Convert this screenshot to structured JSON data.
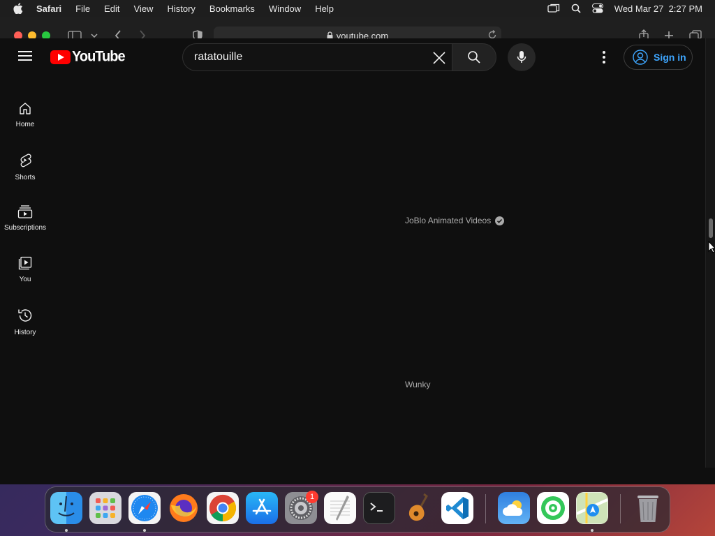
{
  "menubar": {
    "app_name": "Safari",
    "menus": [
      "File",
      "Edit",
      "View",
      "History",
      "Bookmarks",
      "Window",
      "Help"
    ],
    "clock": "Wed Mar 27  2:27 PM"
  },
  "browser": {
    "url": "youtube.com"
  },
  "youtube": {
    "logo_text": "YouTube",
    "search_query": "ratatouille",
    "sign_in_label": "Sign in",
    "nav": [
      {
        "label": "Home",
        "icon": "home-icon"
      },
      {
        "label": "Shorts",
        "icon": "shorts-icon"
      },
      {
        "label": "Subscriptions",
        "icon": "subscriptions-icon"
      },
      {
        "label": "You",
        "icon": "you-icon"
      },
      {
        "label": "History",
        "icon": "history-icon"
      }
    ],
    "results": [
      {
        "channel": "JoBlo Animated Videos",
        "verified": true
      },
      {
        "channel": "Wunky",
        "verified": false
      }
    ]
  },
  "dock": {
    "apps": [
      "Finder",
      "Launchpad",
      "Safari",
      "Firefox",
      "Chrome",
      "App Store",
      "System Settings",
      "TextEdit",
      "Terminal",
      "GarageBand",
      "VS Code",
      "Weather",
      "Find My",
      "Maps",
      "Trash"
    ],
    "settings_badge": "1"
  },
  "colors": {
    "yt_red": "#ff0000",
    "link_blue": "#3ea6ff",
    "page_bg": "#0f0f0f"
  }
}
